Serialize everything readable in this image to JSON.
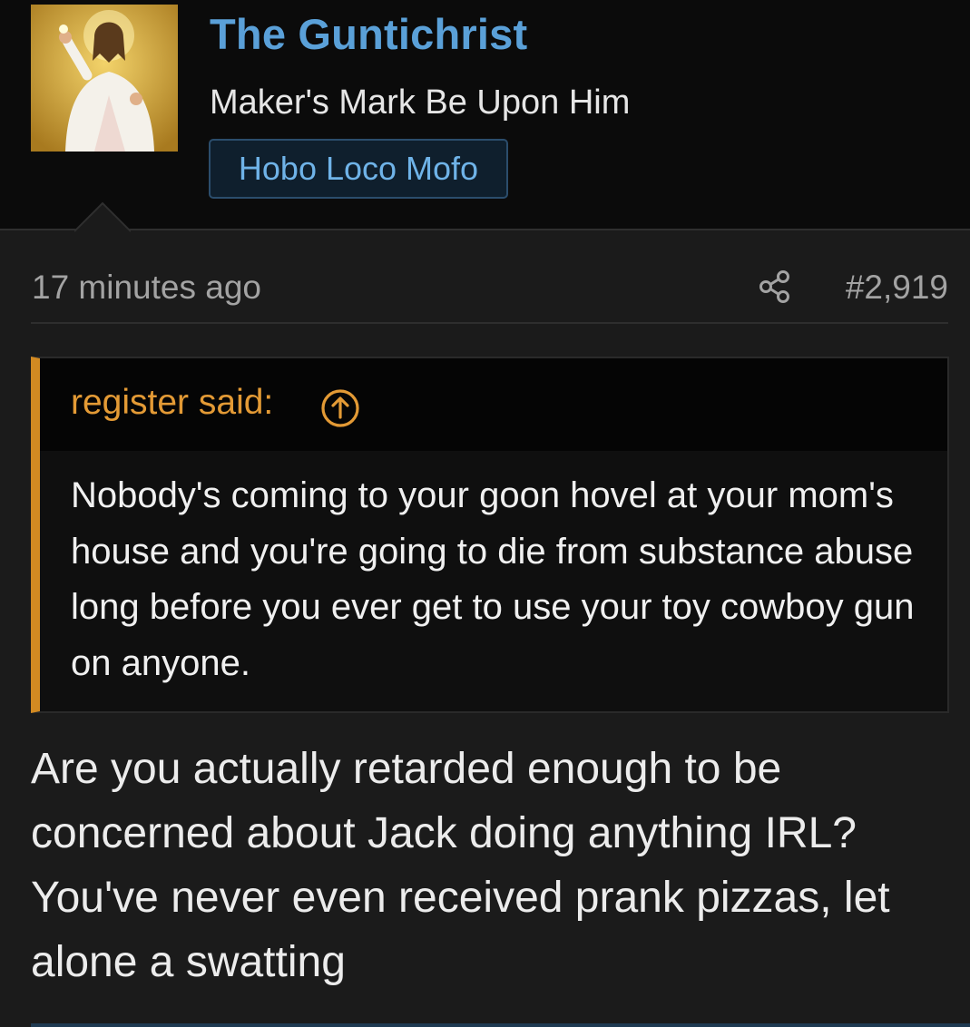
{
  "user": {
    "name": "The Guntichrist",
    "title": "Maker's Mark Be Upon Him",
    "banner": "Hobo Loco Mofo",
    "avatar_icon": "avatar-image"
  },
  "meta": {
    "time": "17 minutes ago",
    "post_number": "#2,919",
    "share_icon": "share-icon"
  },
  "quote": {
    "author_label": "register said:",
    "jump_icon": "arrow-up-circle-icon",
    "text": "Nobody's coming to your goon hovel at your mom's house and you're going to die from substance abuse long before you ever get to use your toy cowboy gun on anyone."
  },
  "post": {
    "text": "Are you actually retarded enough to be concerned about Jack doing anything IRL? You've never even received prank pizzas, let alone a swatting"
  },
  "colors": {
    "username": "#5aa0d8",
    "quote_accent": "#d28a22",
    "banner_text": "#6fb3e8",
    "background": "#1b1b1b"
  }
}
